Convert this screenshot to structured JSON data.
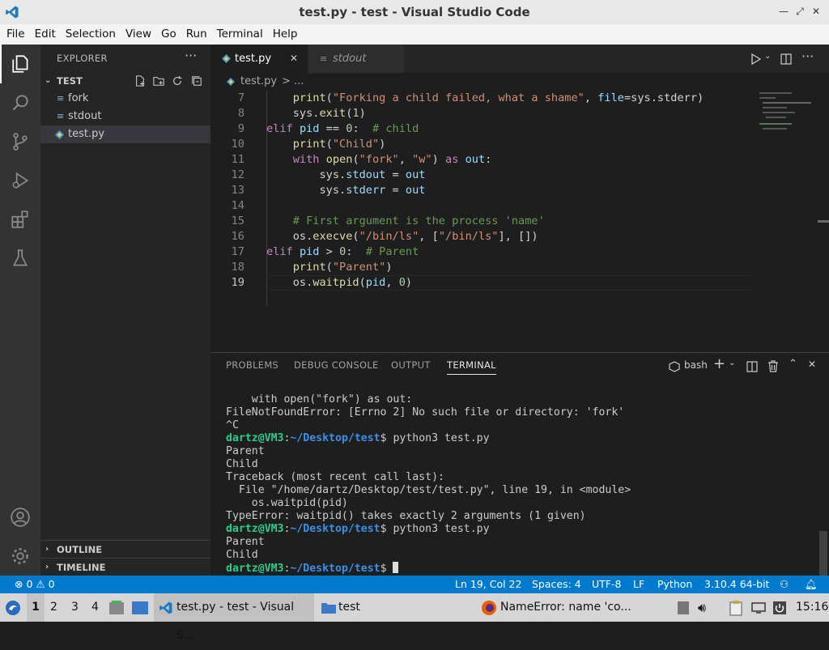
{
  "window": {
    "title": "test.py - test - Visual Studio Code",
    "min": "—",
    "max": "⤢",
    "close": "✕"
  },
  "menu": [
    "File",
    "Edit",
    "Selection",
    "View",
    "Go",
    "Run",
    "Terminal",
    "Help"
  ],
  "sidebar": {
    "header": "EXPLORER",
    "folder": "TEST",
    "files": [
      {
        "name": "fork",
        "icon": "lines"
      },
      {
        "name": "stdout",
        "icon": "lines"
      },
      {
        "name": "test.py",
        "icon": "python"
      }
    ],
    "outline": "OUTLINE",
    "timeline": "TIMELINE"
  },
  "tabs": [
    {
      "label": "test.py",
      "close": "✕"
    },
    {
      "label": "stdout"
    }
  ],
  "breadcrumb": {
    "file": "test.py",
    "more": "> ..."
  },
  "editor": {
    "lines": [
      {
        "n": "7",
        "html": "    <span class='fn'>print</span>(<span class='str'>\"Forking a child failed, what a shame\"</span>, <span class='var'>file</span>=sys.stderr)"
      },
      {
        "n": "8",
        "html": "    sys.<span class='fn'>exit</span>(<span class='num'>1</span>)"
      },
      {
        "n": "9",
        "html": "<span class='kw'>elif</span> <span class='var'>pid</span> == <span class='num'>0</span>:  <span class='cm'># child</span>"
      },
      {
        "n": "10",
        "html": "    <span class='fn'>print</span>(<span class='str'>\"Child\"</span>)"
      },
      {
        "n": "11",
        "html": "    <span class='kw'>with</span> <span class='fn'>open</span>(<span class='str'>\"fork\"</span>, <span class='str'>\"w\"</span>) <span class='kw'>as</span> <span class='var'>out</span>:"
      },
      {
        "n": "12",
        "html": "        sys.<span class='var'>stdout</span> = <span class='var'>out</span>"
      },
      {
        "n": "13",
        "html": "        sys.<span class='var'>stderr</span> = <span class='var'>out</span>"
      },
      {
        "n": "14",
        "html": ""
      },
      {
        "n": "15",
        "html": "    <span class='cm'># First argument is the process 'name'</span>"
      },
      {
        "n": "16",
        "html": "    os.<span class='fn'>execve</span>(<span class='str'>\"/bin/ls\"</span>, [<span class='str'>\"/bin/ls\"</span>], [])"
      },
      {
        "n": "17",
        "html": "<span class='kw'>elif</span> <span class='var'>pid</span> &gt; <span class='num'>0</span>:  <span class='cm'># Parent</span>"
      },
      {
        "n": "18",
        "html": "    <span class='fn'>print</span>(<span class='str'>\"Parent\"</span>)"
      },
      {
        "n": "19",
        "html": "    os.<span class='fn'>waitpid</span>(<span class='var'>pid</span>, <span class='num'>0</span>)"
      }
    ]
  },
  "panel": {
    "tabs": [
      "PROBLEMS",
      "DEBUG CONSOLE",
      "OUTPUT",
      "TERMINAL"
    ],
    "shell": "bash",
    "terminal": [
      {
        "t": "    with open(\"fork\") as out:"
      },
      {
        "t": "FileNotFoundError: [Errno 2] No such file or directory: 'fork'"
      },
      {
        "t": "^C"
      },
      {
        "prompt": true,
        "user": "dartz@VM3",
        "path": "~/Desktop/test",
        "cmd": "$ python3 test.py"
      },
      {
        "t": "Parent"
      },
      {
        "t": "Child"
      },
      {
        "t": "Traceback (most recent call last):"
      },
      {
        "t": "  File \"/home/dartz/Desktop/test/test.py\", line 19, in <module>"
      },
      {
        "t": "    os.waitpid(pid)"
      },
      {
        "t": "TypeError: waitpid() takes exactly 2 arguments (1 given)"
      },
      {
        "prompt": true,
        "user": "dartz@VM3",
        "path": "~/Desktop/test",
        "cmd": "$ python3 test.py"
      },
      {
        "t": "Parent"
      },
      {
        "t": "Child"
      },
      {
        "prompt": true,
        "user": "dartz@VM3",
        "path": "~/Desktop/test",
        "cmd": "$ ",
        "cursor": true
      }
    ]
  },
  "status": {
    "errors": "0",
    "warnings": "0",
    "position": "Ln 19, Col 22",
    "spaces": "Spaces: 4",
    "encoding": "UTF-8",
    "eol": "LF",
    "language": "Python",
    "interpreter": "3.10.4 64-bit"
  },
  "taskbar": {
    "workspaces": [
      "1",
      "2",
      "3",
      "4"
    ],
    "vscode_task": "test.py - test - Visual S...",
    "folder_task": "test",
    "firefox_task": "NameError: name 'co...",
    "clock": "15:16"
  },
  "colors": {
    "accent": "#007acc",
    "activity": "#333333",
    "sidebar": "#252526",
    "editor": "#1e1e1e"
  }
}
